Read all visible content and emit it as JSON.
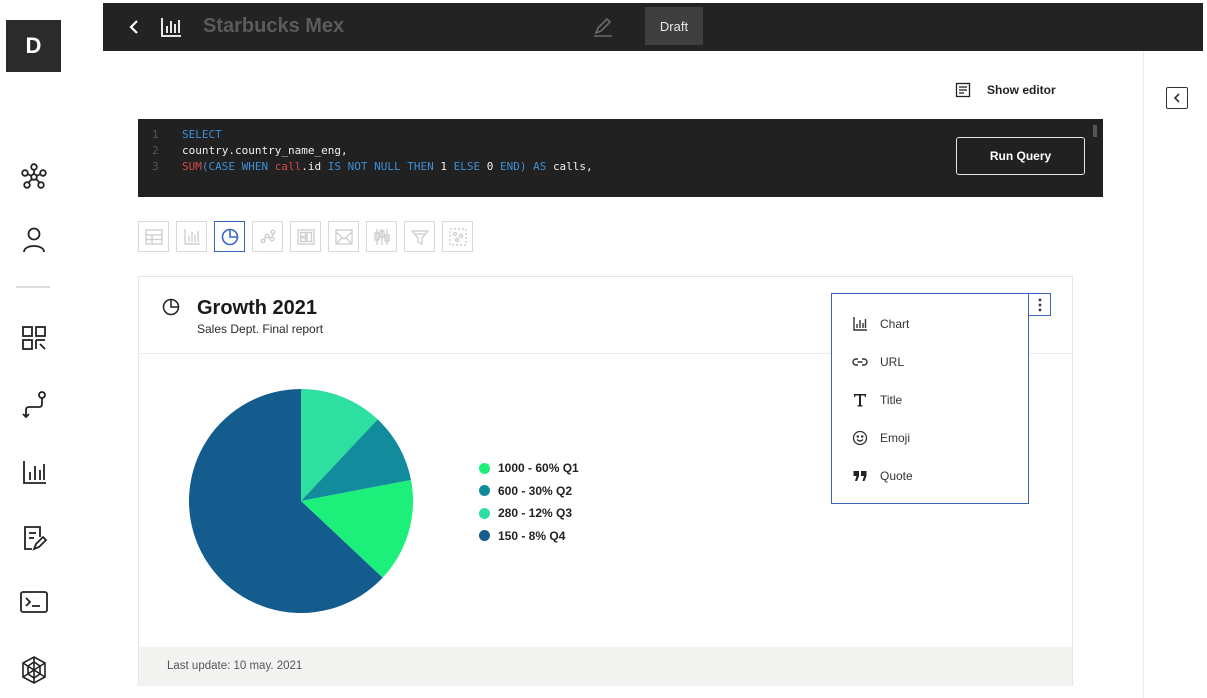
{
  "app": {
    "logo_letter": "D",
    "title": "Starbucks Mex",
    "status_badge": "Draft"
  },
  "sidebar": {
    "items": [
      {
        "icon": "network-icon"
      },
      {
        "icon": "user-icon"
      },
      {
        "icon": "qr-grid-icon"
      },
      {
        "icon": "route-icon"
      },
      {
        "icon": "bar-chart-icon"
      },
      {
        "icon": "document-edit-icon"
      },
      {
        "icon": "terminal-icon"
      },
      {
        "icon": "globe-network-icon"
      }
    ]
  },
  "editor": {
    "show_editor_label": "Show editor",
    "run_query_label": "Run Query",
    "line_numbers": [
      "1",
      "2",
      "3"
    ],
    "line1": {
      "keyword": "SELECT"
    },
    "line2": {
      "text": "country.country_name_eng,"
    },
    "line3": {
      "fn": "SUM",
      "paren_case": "(CASE WHEN ",
      "call": "call",
      "id": ".id ",
      "is_not_null": "IS NOT NULL THEN ",
      "one": "1 ",
      "else": "ELSE ",
      "zero": "0 ",
      "end": "END) AS ",
      "calls": "calls,"
    }
  },
  "chart_types": [
    "table-icon",
    "bar-chart-icon",
    "pie-chart-icon",
    "scatter-icon",
    "layout-icon",
    "map-icon",
    "candlestick-icon",
    "funnel-icon",
    "cluster-icon"
  ],
  "card": {
    "title": "Growth 2021",
    "subtitle": "Sales Dept. Final report",
    "footer": "Last update: 10 may. 2021"
  },
  "menu": {
    "items": [
      {
        "label": "Chart",
        "icon": "chart-icon"
      },
      {
        "label": "URL",
        "icon": "link-icon"
      },
      {
        "label": "Title",
        "icon": "title-icon"
      },
      {
        "label": "Emoji",
        "icon": "emoji-icon"
      },
      {
        "label": "Quote",
        "icon": "quote-icon"
      }
    ]
  },
  "chart_data": {
    "type": "pie",
    "title": "Growth 2021",
    "subtitle": "Sales Dept. Final report",
    "legend_position": "right",
    "categories": [
      "1000 - 60% Q1",
      "600 - 30% Q2",
      "280 - 12% Q3",
      "150 - 8% Q4"
    ],
    "slices": [
      {
        "label": "1000 - 60% Q1",
        "value": 1000,
        "percent": 60,
        "color": "#1cf07a"
      },
      {
        "label": "600 - 30% Q2",
        "value": 600,
        "percent": 30,
        "color": "#128c9c"
      },
      {
        "label": "280 - 12% Q3",
        "value": 280,
        "percent": 12,
        "color": "#2ee0a0"
      },
      {
        "label": "150 - 8% Q4",
        "value": 150,
        "percent": 8,
        "color": "#145c8e"
      }
    ],
    "render_slices": [
      {
        "name": "Q3",
        "percent": 12,
        "color": "#2ee0a0"
      },
      {
        "name": "Q2",
        "percent": 10,
        "color": "#128c9c"
      },
      {
        "name": "Q1",
        "percent": 15,
        "color": "#1cf07a"
      },
      {
        "name": "Q4",
        "percent": 63,
        "color": "#145c8e"
      }
    ]
  },
  "colors": {
    "topbar": "#232323",
    "accent": "#3a66c0",
    "editor_bg": "#212121"
  }
}
